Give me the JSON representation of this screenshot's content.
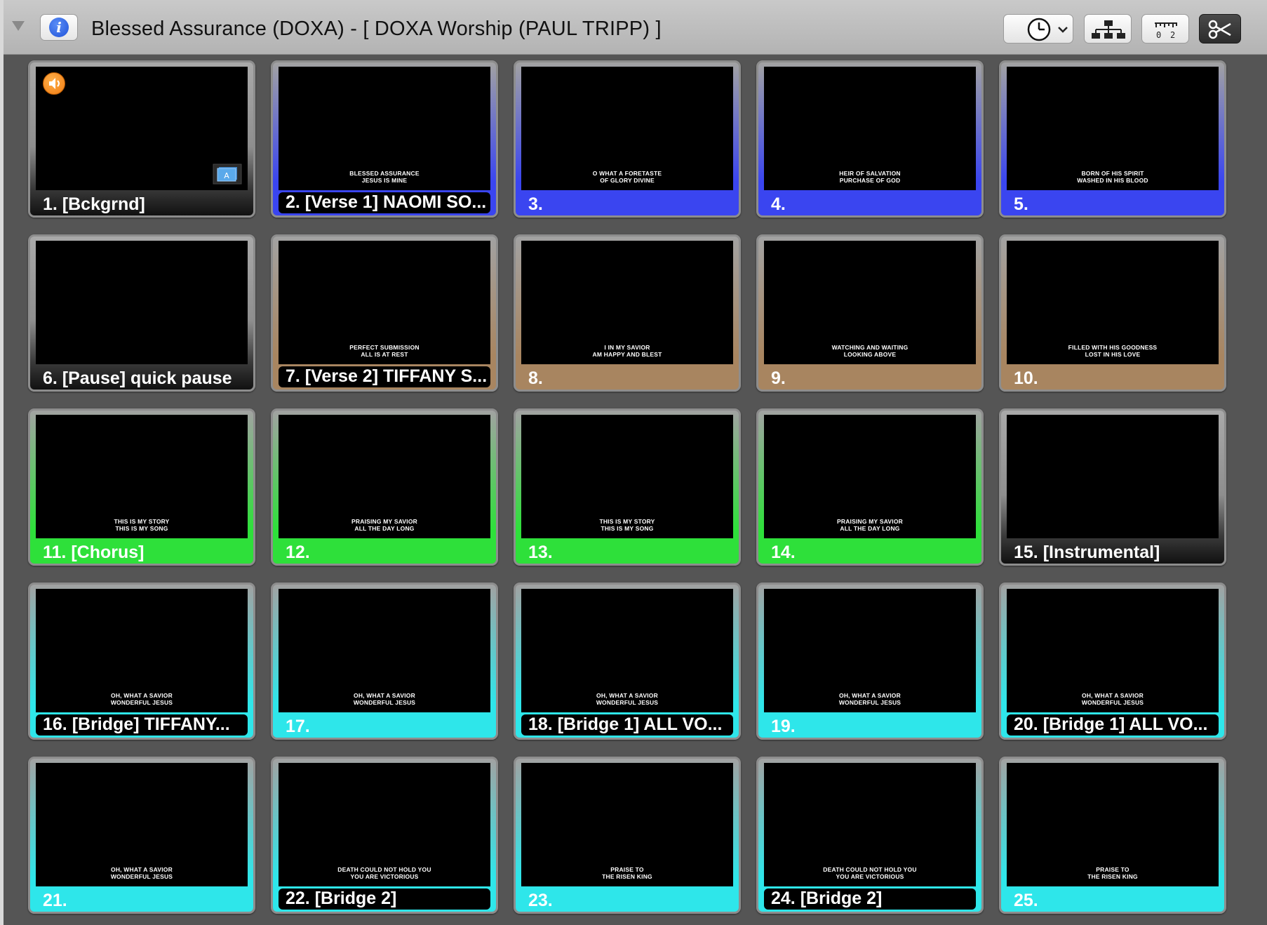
{
  "window": {
    "title": "Blessed Assurance (DOXA) - [ DOXA Worship (PAUL TRIPP)  ]"
  },
  "toolbar": {
    "info_icon": "info-icon",
    "info_glyph": "i",
    "timer_icon": "clock-icon",
    "arrangement_icon": "hierarchy-icon",
    "counter_icon": "ruler-counter-icon",
    "scissors_icon": "scissors-icon"
  },
  "colors": {
    "blue": "#3a45f0",
    "tan": "#a88560",
    "green": "#2ee03a",
    "cyan": "#2ee6ea",
    "none": "#1a1a1a"
  },
  "slides": [
    {
      "label": "1. [Bckgrnd]",
      "lyric": "",
      "group": "none",
      "pill": false,
      "audio": true
    },
    {
      "label": "2. [Verse 1] NAOMI SO...",
      "lyric": "BLESSED ASSURANCE\nJESUS IS MINE",
      "group": "blue",
      "pill": true
    },
    {
      "label": "3.",
      "lyric": "O WHAT A FORETASTE\nOF GLORY DIVINE",
      "group": "blue",
      "pill": false
    },
    {
      "label": "4.",
      "lyric": "HEIR OF SALVATION\nPURCHASE OF GOD",
      "group": "blue",
      "pill": false
    },
    {
      "label": "5.",
      "lyric": "BORN OF HIS SPIRIT\nWASHED IN HIS BLOOD",
      "group": "blue",
      "pill": false
    },
    {
      "label": "6. [Pause] quick pause",
      "lyric": "",
      "group": "none",
      "pill": false
    },
    {
      "label": "7. [Verse 2] TIFFANY S...",
      "lyric": "PERFECT SUBMISSION\nALL IS AT REST",
      "group": "tan",
      "pill": true
    },
    {
      "label": "8.",
      "lyric": "I IN MY SAVIOR\nAM HAPPY AND BLEST",
      "group": "tan",
      "pill": false
    },
    {
      "label": "9.",
      "lyric": "WATCHING AND WAITING\nLOOKING ABOVE",
      "group": "tan",
      "pill": false
    },
    {
      "label": "10.",
      "lyric": "FILLED WITH HIS GOODNESS\nLOST IN HIS LOVE",
      "group": "tan",
      "pill": false
    },
    {
      "label": "11. [Chorus]",
      "lyric": "THIS IS MY STORY\nTHIS IS MY SONG",
      "group": "green",
      "pill": false
    },
    {
      "label": "12.",
      "lyric": "PRAISING MY SAVIOR\nALL THE DAY LONG",
      "group": "green",
      "pill": false
    },
    {
      "label": "13.",
      "lyric": "THIS IS MY STORY\nTHIS IS MY SONG",
      "group": "green",
      "pill": false
    },
    {
      "label": "14.",
      "lyric": "PRAISING MY SAVIOR\nALL THE DAY LONG",
      "group": "green",
      "pill": false
    },
    {
      "label": "15. [Instrumental]",
      "lyric": "",
      "group": "none",
      "pill": false
    },
    {
      "label": "16. [Bridge] TIFFANY...",
      "lyric": "OH, WHAT A SAVIOR\nWONDERFUL JESUS",
      "group": "cyan",
      "pill": true
    },
    {
      "label": "17.",
      "lyric": "OH, WHAT A SAVIOR\nWONDERFUL JESUS",
      "group": "cyan",
      "pill": false
    },
    {
      "label": "18. [Bridge 1] ALL VO...",
      "lyric": "OH, WHAT A SAVIOR\nWONDERFUL JESUS",
      "group": "cyan",
      "pill": true
    },
    {
      "label": "19.",
      "lyric": "OH, WHAT A SAVIOR\nWONDERFUL JESUS",
      "group": "cyan",
      "pill": false
    },
    {
      "label": "20. [Bridge 1] ALL VO...",
      "lyric": "OH, WHAT A SAVIOR\nWONDERFUL JESUS",
      "group": "cyan",
      "pill": true
    },
    {
      "label": "21.",
      "lyric": "OH, WHAT A SAVIOR\nWONDERFUL JESUS",
      "group": "cyan",
      "pill": false
    },
    {
      "label": "22. [Bridge 2]",
      "lyric": "DEATH COULD NOT HOLD YOU\nYOU ARE VICTORIOUS",
      "group": "cyan",
      "pill": true
    },
    {
      "label": "23.",
      "lyric": "PRAISE TO\nTHE RISEN KING",
      "group": "cyan",
      "pill": false
    },
    {
      "label": "24. [Bridge 2]",
      "lyric": "DEATH COULD NOT HOLD YOU\nYOU ARE VICTORIOUS",
      "group": "cyan",
      "pill": true
    },
    {
      "label": "25.",
      "lyric": "PRAISE TO\nTHE RISEN KING",
      "group": "cyan",
      "pill": false
    }
  ],
  "background_layer_icon": "layer-a-icon",
  "background_layer_letter": "A",
  "audio_icon": "speaker-icon"
}
